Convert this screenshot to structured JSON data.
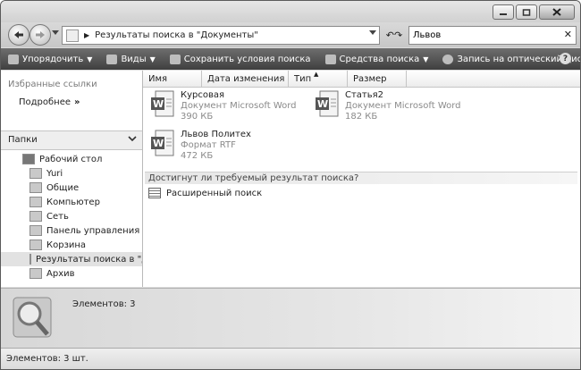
{
  "window": {
    "minimize_icon": "minimize-icon",
    "maximize_icon": "maximize-icon",
    "close_icon": "close-icon"
  },
  "navigation": {
    "address_text": "Результаты поиска в \"Документы\"",
    "search_value": "Львов"
  },
  "toolbar": {
    "organize": "Упорядочить",
    "views": "Виды",
    "save_search": "Сохранить условия поиска",
    "search_tools": "Средства поиска",
    "burn": "Запись на оптический диск"
  },
  "sidebar": {
    "favorites_title": "Избранные ссылки",
    "more_label": "Подробнее",
    "more_arrow": "»",
    "folders_title": "Папки",
    "tree": [
      {
        "label": "Рабочий стол"
      },
      {
        "label": "Yuri"
      },
      {
        "label": "Общие"
      },
      {
        "label": "Компьютер"
      },
      {
        "label": "Сеть"
      },
      {
        "label": "Панель управления"
      },
      {
        "label": "Корзина"
      },
      {
        "label": "Результаты поиска в \"Д"
      },
      {
        "label": "Архив"
      }
    ]
  },
  "columns": {
    "name": "Имя",
    "date": "Дата изменения",
    "type": "Тип",
    "size": "Размер"
  },
  "files": [
    {
      "name": "Курсовая",
      "type": "Документ Microsoft Word",
      "size": "390 КБ"
    },
    {
      "name": "Статья2",
      "type": "Документ Microsoft Word",
      "size": "182 КБ"
    },
    {
      "name": "Львов Политех",
      "type": "Формат RTF",
      "size": "472 КБ"
    }
  ],
  "search_prompt": "Достигнут ли требуемый результат поиска?",
  "advanced_search": "Расширенный поиск",
  "details": {
    "count_label": "Элементов: 3"
  },
  "status": {
    "text": "Элементов: 3 шт."
  },
  "colors": {
    "toolbar_bg": "#555555",
    "window_bg": "#dcdcdc"
  }
}
